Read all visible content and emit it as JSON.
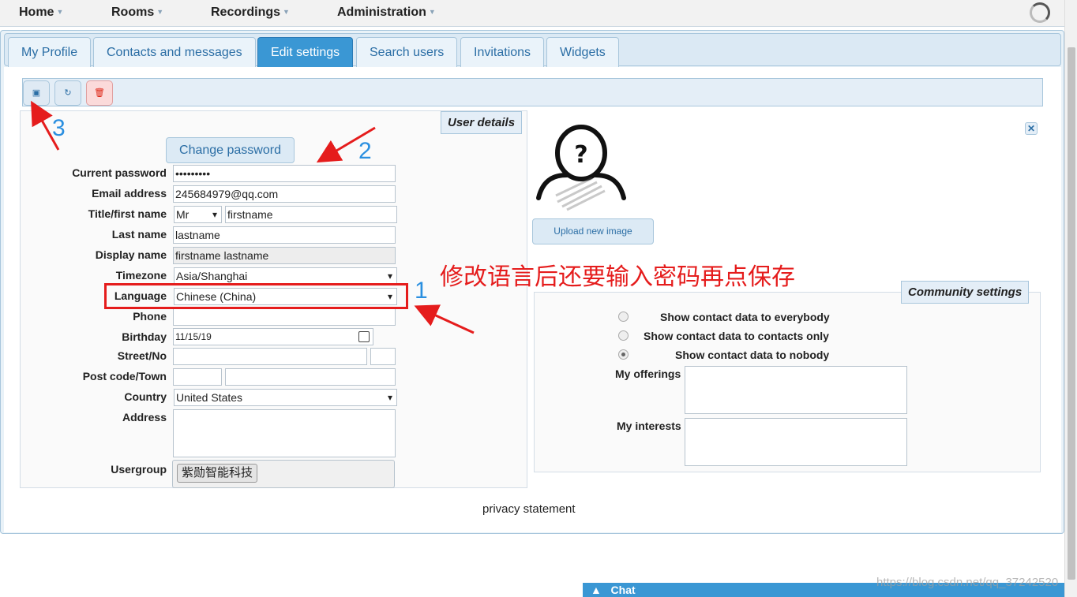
{
  "menu": {
    "items": [
      {
        "label": "Home"
      },
      {
        "label": "Rooms"
      },
      {
        "label": "Recordings"
      },
      {
        "label": "Administration"
      }
    ]
  },
  "tabs": [
    {
      "label": "My Profile"
    },
    {
      "label": "Contacts and messages"
    },
    {
      "label": "Edit settings",
      "active": true
    },
    {
      "label": "Search users"
    },
    {
      "label": "Invitations"
    },
    {
      "label": "Widgets"
    }
  ],
  "toolbar": {
    "save_icon": "save-icon",
    "refresh_icon": "refresh-icon",
    "delete_icon": "trash-icon"
  },
  "user_details": {
    "legend": "User details",
    "change_password": "Change password",
    "labels": {
      "current_password": "Current password",
      "email": "Email address",
      "title_first": "Title/first name",
      "last_name": "Last name",
      "display_name": "Display name",
      "timezone": "Timezone",
      "language": "Language",
      "phone": "Phone",
      "birthday": "Birthday",
      "street": "Street/No",
      "post_town": "Post code/Town",
      "country": "Country",
      "address": "Address",
      "usergroup": "Usergroup"
    },
    "values": {
      "current_password": "•••••••••",
      "email": "245684979@qq.com",
      "title": "Mr",
      "first_name": "firstname",
      "last_name": "lastname",
      "display_name": "firstname lastname",
      "timezone": "Asia/Shanghai",
      "language": "Chinese (China)",
      "phone": "",
      "birthday": "11/15/19",
      "country": "United States",
      "usergroup": "紫勋智能科技"
    }
  },
  "avatar": {
    "upload_label": "Upload new image"
  },
  "community": {
    "legend": "Community settings",
    "options": [
      {
        "label": "Show contact data to everybody",
        "checked": false
      },
      {
        "label": "Show contact data to contacts only",
        "checked": false
      },
      {
        "label": "Show contact data to nobody",
        "checked": true
      }
    ],
    "offerings_label": "My offerings",
    "interests_label": "My interests"
  },
  "privacy": "privacy statement",
  "annotations": {
    "note": "修改语言后还要输入密码再点保存",
    "n1": "1",
    "n2": "2",
    "n3": "3"
  },
  "chat": {
    "label": "Chat"
  },
  "watermark": "https://blog.csdn.net/qq_37242520",
  "colors": {
    "accent": "#3a97d4",
    "annotation_red": "#e51c1c",
    "annotation_blue": "#2a8fe0"
  }
}
